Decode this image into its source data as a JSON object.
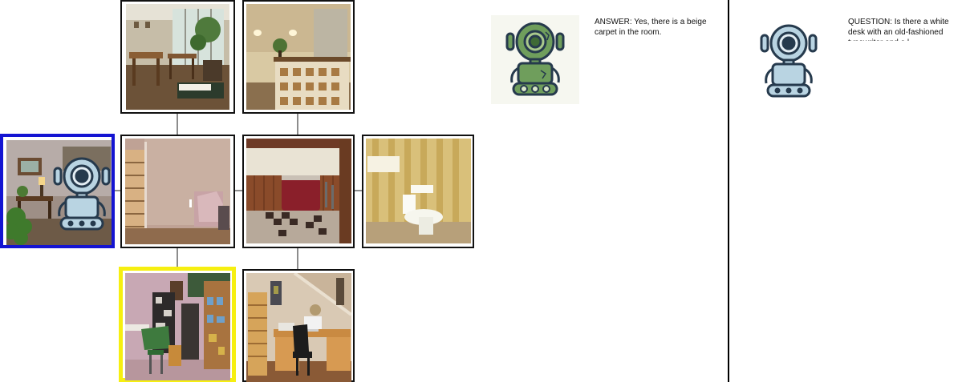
{
  "answer_panel": {
    "text": "ANSWER: Yes, there is a beige carpet in the room."
  },
  "question_panel": {
    "text": "QUESTION: Is there a white desk with an old-fashioned typewriter and a l"
  },
  "colors": {
    "active_border": "#1414d2",
    "target_border": "#f6ef10",
    "oracle_robot": "#6f9e5c",
    "navigator_robot": "#b9d4e2",
    "outline": "#263a4d"
  },
  "icons": {
    "oracle": "green-robot-icon",
    "navigator": "blue-robot-icon"
  },
  "rooms": [
    "dining-room",
    "bar-counter-room",
    "living-room",
    "staircase-basement",
    "basement-bar",
    "bathroom-toilet",
    "home-office",
    "study-desk"
  ]
}
